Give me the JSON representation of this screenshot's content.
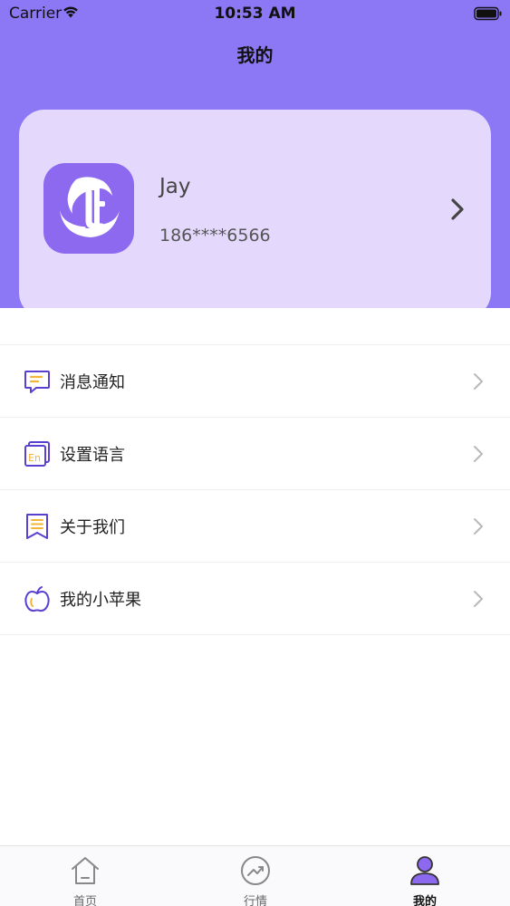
{
  "status_bar": {
    "carrier": "Carrier",
    "time": "10:53 AM"
  },
  "header": {
    "title": "我的"
  },
  "profile": {
    "name": "Jay",
    "phone": "186****6566"
  },
  "menu": {
    "items": [
      {
        "label": "消息通知",
        "icon": "message-icon"
      },
      {
        "label": "设置语言",
        "icon": "language-icon"
      },
      {
        "label": "关于我们",
        "icon": "about-icon"
      },
      {
        "label": "我的小苹果",
        "icon": "apple-icon"
      }
    ]
  },
  "tab_bar": {
    "tabs": [
      {
        "label": "首页",
        "icon": "home-icon",
        "active": false
      },
      {
        "label": "行情",
        "icon": "trend-icon",
        "active": false
      },
      {
        "label": "我的",
        "icon": "profile-icon",
        "active": true
      }
    ]
  },
  "colors": {
    "header_bg": "#8c78f5",
    "card_bg": "#e4d8fd",
    "avatar_bg": "#8d69ef",
    "icon_purple": "#5b3fd0",
    "icon_yellow": "#f3b43a"
  }
}
